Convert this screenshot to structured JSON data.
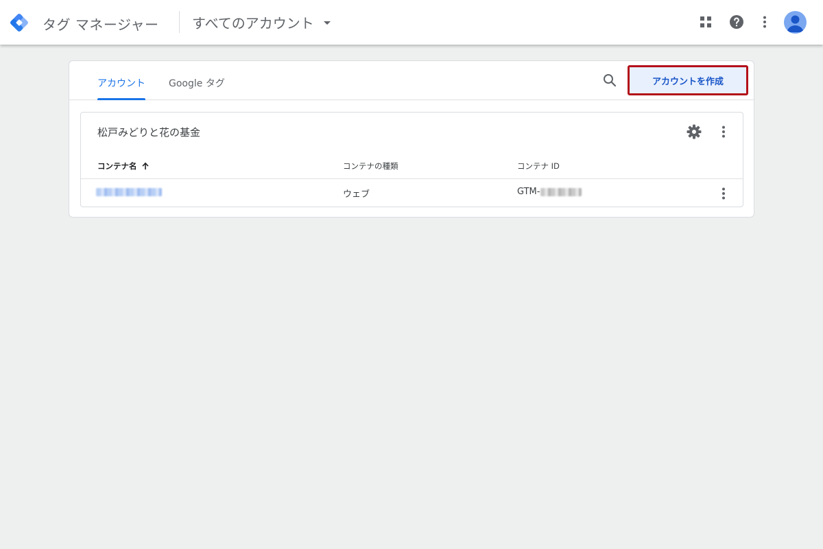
{
  "appbar": {
    "app_name": "タグ マネージャー",
    "account_switcher_label": "すべてのアカウント",
    "icons": [
      "apps-grid-icon",
      "help-icon",
      "more-vert-icon",
      "account-avatar-icon"
    ]
  },
  "tabs": [
    {
      "label": "アカウント",
      "active": true
    },
    {
      "label": "Google タグ",
      "active": false
    }
  ],
  "toolbar": {
    "create_account_label": "アカウントを作成"
  },
  "account": {
    "name": "松戸みどりと花の基金",
    "table": {
      "columns": [
        "コンテナ名",
        "コンテナの種類",
        "コンテナ ID"
      ],
      "sort_column": "コンテナ名",
      "sort_direction": "ascending",
      "rows": [
        {
          "type": "ウェブ",
          "id_prefix": "GTM-"
        }
      ]
    }
  },
  "colors": {
    "accent": "#1a73e8",
    "highlight_border": "#b3101a",
    "background": "#eef0f0"
  }
}
